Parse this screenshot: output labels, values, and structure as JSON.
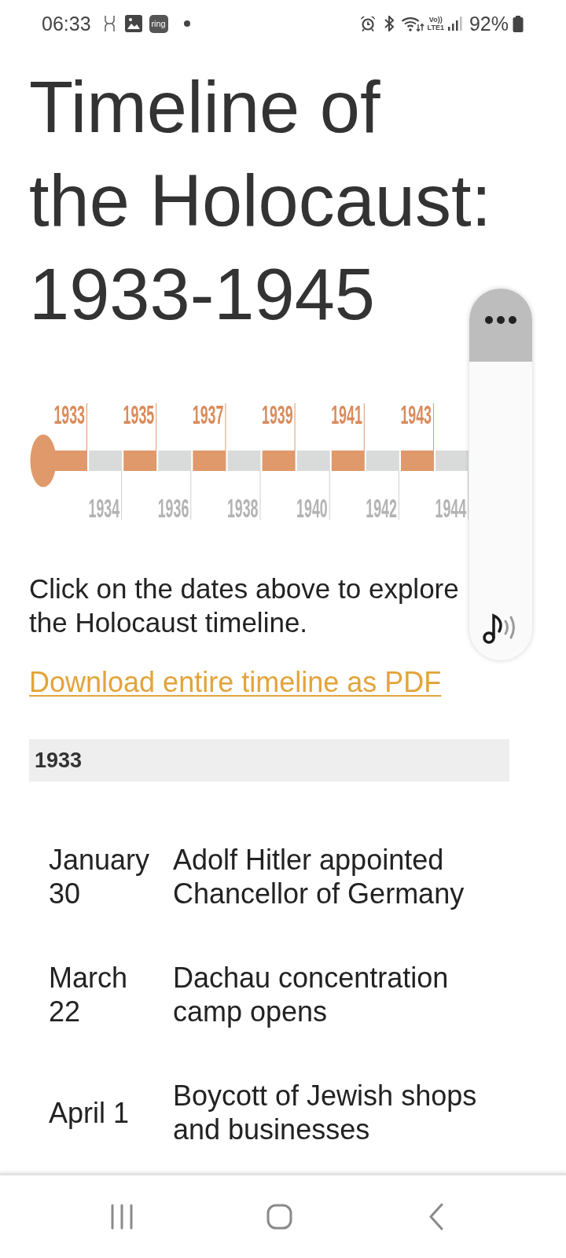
{
  "status_bar": {
    "time": "06:33",
    "app_badge": "ring",
    "network_top": "Vo))",
    "network_bottom": "LTE1",
    "battery_percent": "92%"
  },
  "title": "Timeline of the Holocaust: 1933-1945",
  "timeline": {
    "years": [
      {
        "label": "1933",
        "kind": "major"
      },
      {
        "label": "1934",
        "kind": "minor"
      },
      {
        "label": "1935",
        "kind": "major"
      },
      {
        "label": "1936",
        "kind": "minor"
      },
      {
        "label": "1937",
        "kind": "major"
      },
      {
        "label": "1938",
        "kind": "minor"
      },
      {
        "label": "1939",
        "kind": "major"
      },
      {
        "label": "1940",
        "kind": "minor"
      },
      {
        "label": "1941",
        "kind": "major"
      },
      {
        "label": "1942",
        "kind": "minor"
      },
      {
        "label": "1943",
        "kind": "major"
      },
      {
        "label": "1944",
        "kind": "minor"
      }
    ]
  },
  "intro": "Click on the dates above to explore the Holocaust timeline.",
  "download_link": "Download entire timeline as PDF",
  "year_section": {
    "year": "1933",
    "events": [
      {
        "date": "January 30",
        "description": "Adolf Hitler appointed Chancellor of Germany"
      },
      {
        "date": "March 22",
        "description": "Dachau concentration camp opens"
      },
      {
        "date": "April 1",
        "description": "Boycott of Jewish shops and businesses"
      }
    ]
  }
}
